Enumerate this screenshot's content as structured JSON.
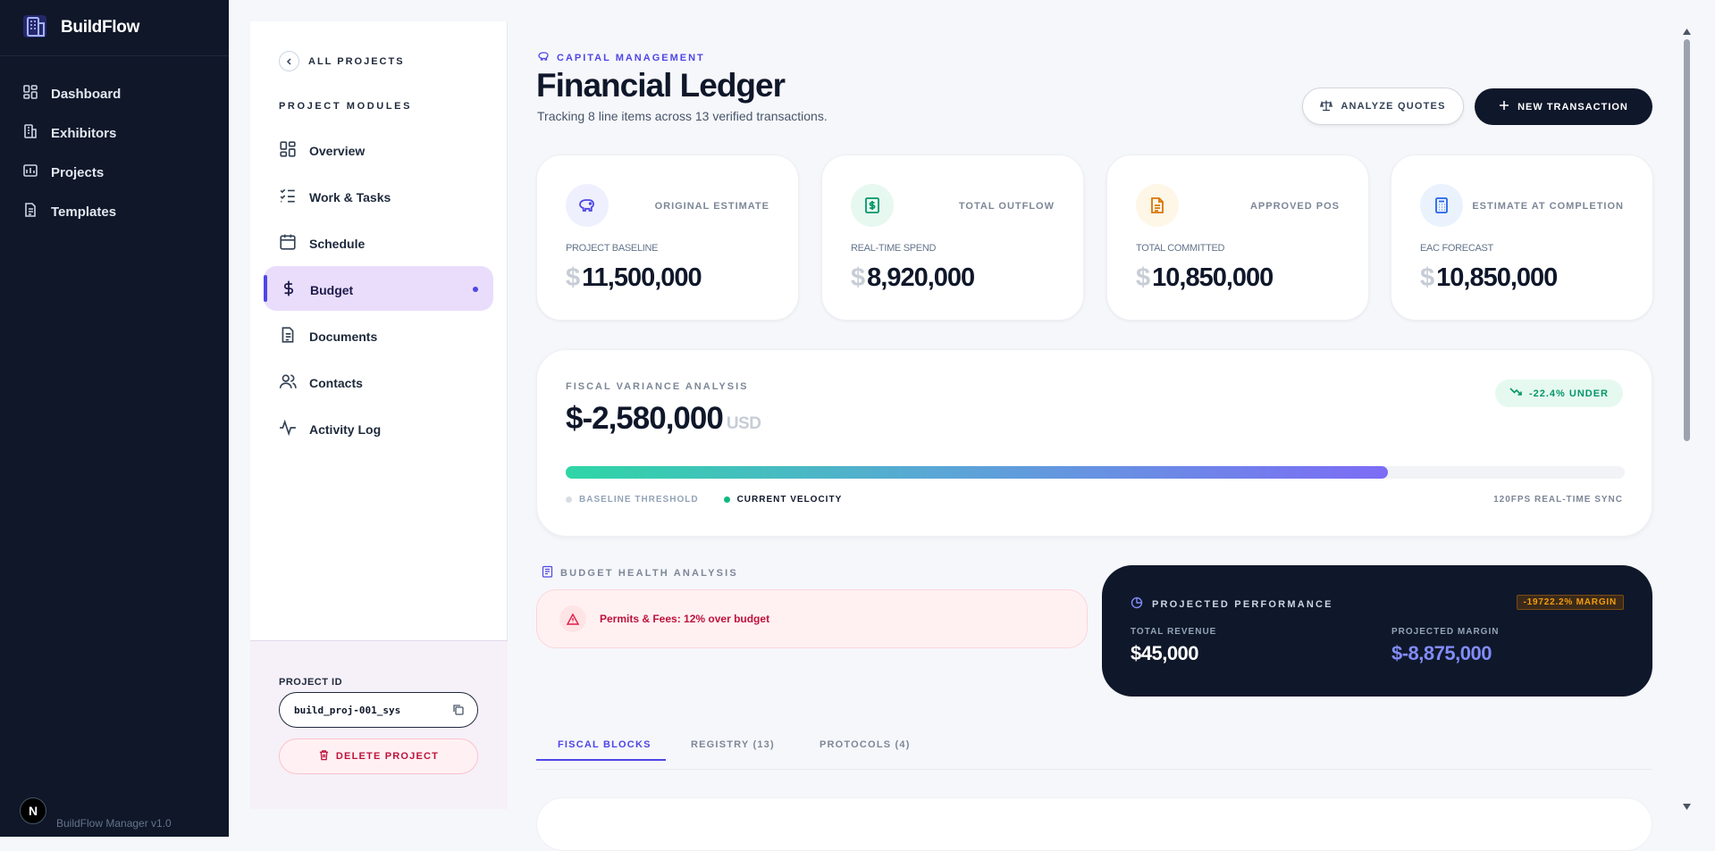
{
  "app": {
    "name": "BuildFlow",
    "version": "BuildFlow Manager v1.0",
    "badge": "N"
  },
  "sidebar": {
    "items": [
      {
        "label": "Dashboard",
        "icon": "grid-icon"
      },
      {
        "label": "Exhibitors",
        "icon": "building-icon"
      },
      {
        "label": "Projects",
        "icon": "chart-folder-icon"
      },
      {
        "label": "Templates",
        "icon": "document-icon"
      }
    ]
  },
  "panel": {
    "back_label": "ALL PROJECTS",
    "modules_label": "PROJECT MODULES",
    "modules": [
      {
        "label": "Overview"
      },
      {
        "label": "Work & Tasks"
      },
      {
        "label": "Schedule"
      },
      {
        "label": "Budget",
        "active": true
      },
      {
        "label": "Documents"
      },
      {
        "label": "Contacts"
      },
      {
        "label": "Activity Log"
      }
    ],
    "project_id_label": "PROJECT ID",
    "project_id": "build_proj-001_sys",
    "delete_label": "DELETE PROJECT"
  },
  "header": {
    "kicker": "CAPITAL MANAGEMENT",
    "title": "Financial Ledger",
    "subtitle": "Tracking 8 line items across 13 verified transactions.",
    "analyze_label": "ANALYZE QUOTES",
    "new_label": "NEW TRANSACTION"
  },
  "kpis": [
    {
      "right_label": "ORIGINAL ESTIMATE",
      "label": "PROJECT BASELINE",
      "currency": "$",
      "value": "11,500,000",
      "icon": "piggy-bank-icon",
      "color": "#4f46e5"
    },
    {
      "right_label": "TOTAL OUTFLOW",
      "label": "REAL-TIME SPEND",
      "currency": "$",
      "value": "8,920,000",
      "icon": "cash-icon",
      "color": "#059669"
    },
    {
      "right_label": "APPROVED POS",
      "label": "TOTAL COMMITTED",
      "currency": "$",
      "value": "10,850,000",
      "icon": "document-icon",
      "color": "#d97706"
    },
    {
      "right_label": "ESTIMATE AT COMPLETION",
      "label": "EAC FORECAST",
      "currency": "$",
      "value": "10,850,000",
      "icon": "calculator-icon",
      "color": "#2563eb"
    }
  ],
  "variance": {
    "label": "FISCAL VARIANCE ANALYSIS",
    "value": "$-2,580,000",
    "unit": "USD",
    "badge": "-22.4% UNDER",
    "progress": 0.776,
    "legend_baseline": "BASELINE THRESHOLD",
    "legend_current": "CURRENT VELOCITY",
    "sync": "120FPS REAL-TIME SYNC"
  },
  "health": {
    "label": "BUDGET HEALTH ANALYSIS",
    "alert": "Permits & Fees: 12% over budget"
  },
  "performance": {
    "label": "PROJECTED PERFORMANCE",
    "badge": "-19722.2% MARGIN",
    "revenue_label": "TOTAL REVENUE",
    "revenue": "$45,000",
    "margin_label": "PROJECTED MARGIN",
    "margin": "$-8,875,000"
  },
  "tabs": [
    {
      "label": "FISCAL BLOCKS",
      "active": true
    },
    {
      "label": "REGISTRY (13)"
    },
    {
      "label": "PROTOCOLS (4)"
    }
  ],
  "colors": {
    "accent": "#4f46e5",
    "sidebar_bg": "#0f1729",
    "success": "#059669",
    "danger": "#be123c",
    "warning": "#f59e0b"
  }
}
